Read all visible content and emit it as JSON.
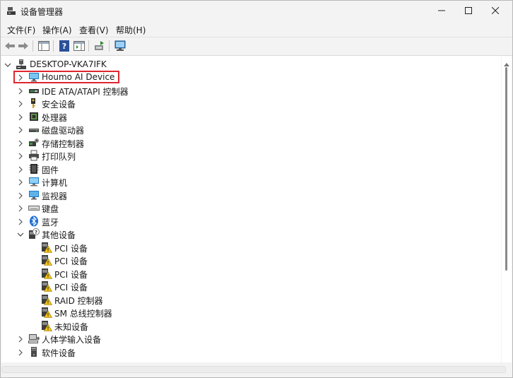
{
  "window": {
    "title": "设备管理器",
    "app_icon": "device-manager-icon",
    "controls": [
      "minimize-icon",
      "maximize-icon",
      "close-icon"
    ]
  },
  "menu": [
    "文件(F)",
    "操作(A)",
    "查看(V)",
    "帮助(H)"
  ],
  "toolbar": [
    "back-arrow-icon",
    "forward-arrow-icon",
    "properties-pane-icon",
    "help-icon",
    "action-pane-icon",
    "update-driver-icon",
    "scan-hardware-icon"
  ],
  "tree": {
    "root": "DESKTOP-VKA7IFK",
    "items": [
      {
        "label": "Houmo AI Device",
        "icon": "monitor-device-icon",
        "expanded": false,
        "highlighted": true
      },
      {
        "label": "IDE ATA/ATAPI 控制器",
        "icon": "ide-controller-icon",
        "expanded": false
      },
      {
        "label": "安全设备",
        "icon": "security-key-icon",
        "expanded": false
      },
      {
        "label": "处理器",
        "icon": "processor-icon",
        "expanded": false
      },
      {
        "label": "磁盘驱动器",
        "icon": "disk-drive-icon",
        "expanded": false
      },
      {
        "label": "存储控制器",
        "icon": "storage-controller-icon",
        "expanded": false
      },
      {
        "label": "打印队列",
        "icon": "printer-icon",
        "expanded": false
      },
      {
        "label": "固件",
        "icon": "firmware-icon",
        "expanded": false
      },
      {
        "label": "计算机",
        "icon": "computer-icon",
        "expanded": false
      },
      {
        "label": "监视器",
        "icon": "monitor-icon",
        "expanded": false
      },
      {
        "label": "键盘",
        "icon": "keyboard-icon",
        "expanded": false
      },
      {
        "label": "蓝牙",
        "icon": "bluetooth-icon",
        "expanded": false
      },
      {
        "label": "其他设备",
        "icon": "unknown-device-icon",
        "expanded": true,
        "children": [
          {
            "label": "PCI 设备",
            "icon": "warning-device-icon"
          },
          {
            "label": "PCI 设备",
            "icon": "warning-device-icon"
          },
          {
            "label": "PCI 设备",
            "icon": "warning-device-icon"
          },
          {
            "label": "PCI 设备",
            "icon": "warning-device-icon"
          },
          {
            "label": "RAID 控制器",
            "icon": "warning-device-icon"
          },
          {
            "label": "SM 总线控制器",
            "icon": "warning-device-icon"
          },
          {
            "label": "未知设备",
            "icon": "warning-device-icon"
          }
        ]
      },
      {
        "label": "人体学输入设备",
        "icon": "hid-icon",
        "expanded": false
      },
      {
        "label": "软件设备",
        "icon": "software-device-icon",
        "expanded": false
      }
    ]
  },
  "colors": {
    "highlight_box": "#e0262f",
    "window_bg": "#f3f3f3",
    "tree_bg": "#ffffff"
  }
}
